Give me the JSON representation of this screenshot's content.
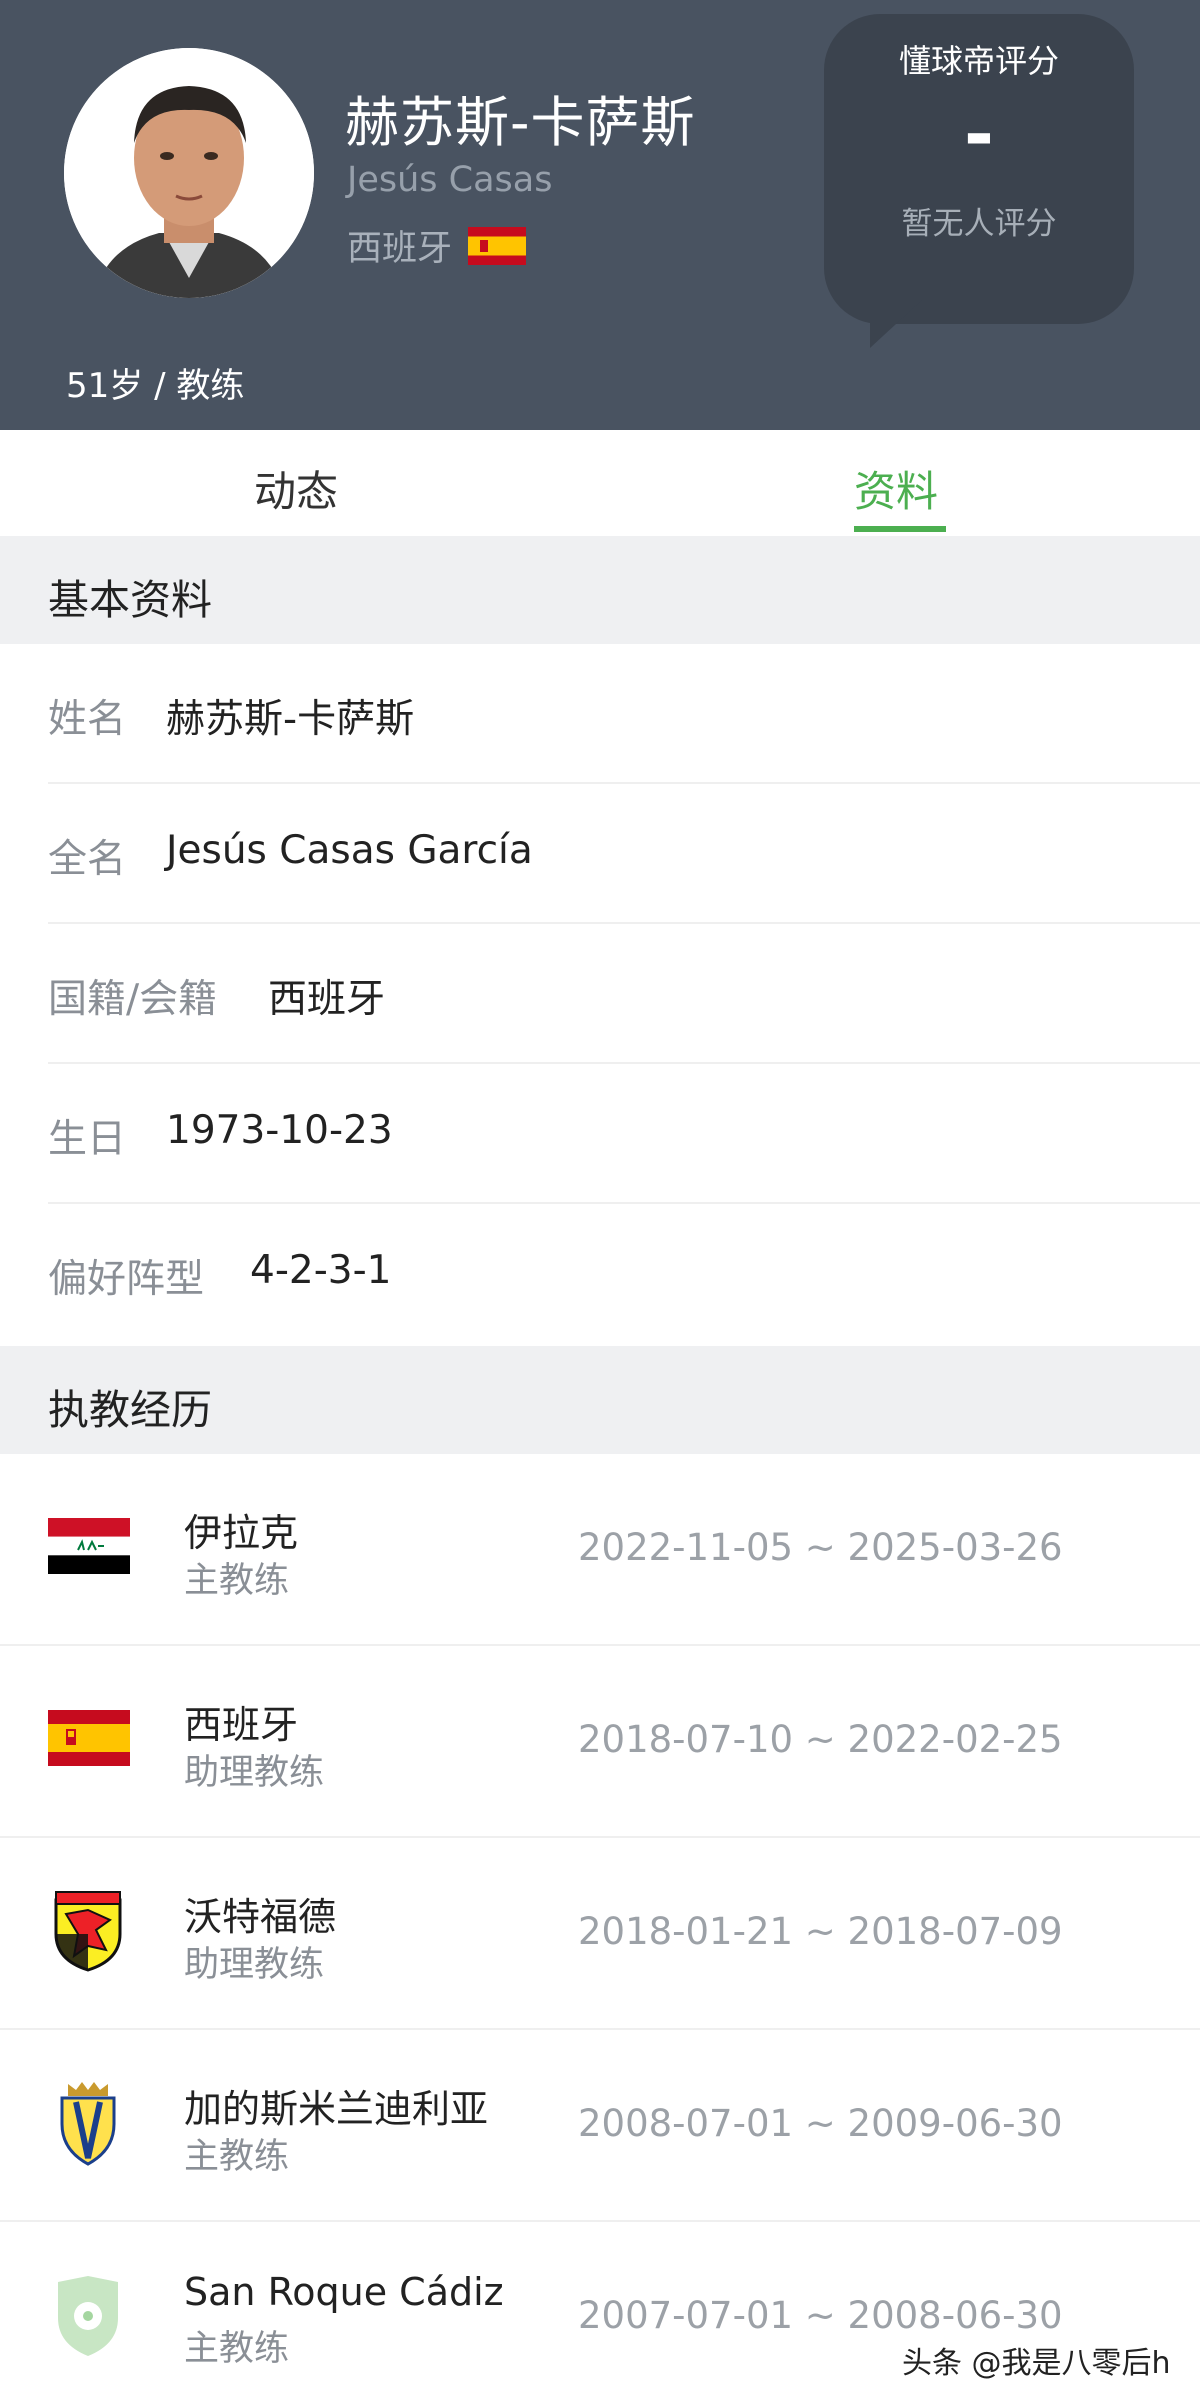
{
  "header": {
    "name_cn": "赫苏斯-卡萨斯",
    "name_en": "Jesús Casas",
    "nationality": "西班牙",
    "age_role": "51岁 / 教练",
    "rating": {
      "title": "懂球帝评分",
      "value": "-",
      "subtitle": "暂无人评分"
    }
  },
  "tabs": [
    {
      "label": "动态",
      "active": false
    },
    {
      "label": "资料",
      "active": true
    }
  ],
  "basic_info": {
    "section_title": "基本资料",
    "rows": [
      {
        "label": "姓名",
        "value": "赫苏斯-卡萨斯"
      },
      {
        "label": "全名",
        "value": "Jesús Casas García"
      },
      {
        "label": "国籍/会籍",
        "value": "西班牙"
      },
      {
        "label": "生日",
        "value": "1973-10-23"
      },
      {
        "label": "偏好阵型",
        "value": "4-2-3-1"
      }
    ]
  },
  "career": {
    "section_title": "执教经历",
    "items": [
      {
        "team": "伊拉克",
        "role": "主教练",
        "period": "2022-11-05 ~ 2025-03-26",
        "logo": "iraq-flag-icon"
      },
      {
        "team": "西班牙",
        "role": "助理教练",
        "period": "2018-07-10 ~ 2022-02-25",
        "logo": "spain-flag-icon"
      },
      {
        "team": "沃特福德",
        "role": "助理教练",
        "period": "2018-01-21 ~ 2018-07-09",
        "logo": "watford-crest-icon"
      },
      {
        "team": "加的斯米兰迪利亚",
        "role": "主教练",
        "period": "2008-07-01 ~ 2009-06-30",
        "logo": "cadiz-crest-icon"
      },
      {
        "team": "San Roque Cádiz",
        "role": "主教练",
        "period": "2007-07-01 ~ 2008-06-30",
        "logo": "generic-shield-icon"
      }
    ]
  },
  "watermark": "头条 @我是八零后h",
  "colors": {
    "header_bg": "#495361",
    "accent_green": "#4caf50",
    "section_bg": "#eff0f2"
  }
}
